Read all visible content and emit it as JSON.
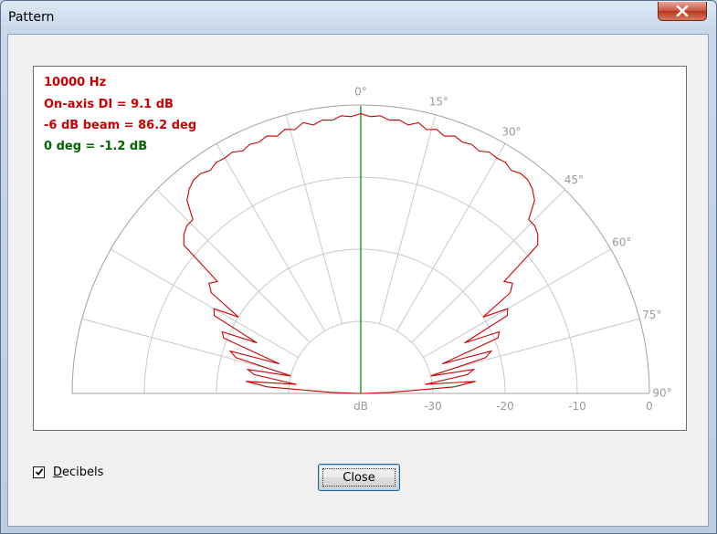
{
  "window": {
    "title": "Pattern"
  },
  "chart_data": {
    "type": "polar",
    "frequency_text": "10000 Hz",
    "di_text": "On-axis DI = 9.1 dB",
    "beam_text": "-6 dB beam = 86.2 deg",
    "zero_deg_text": "0 deg = -1.2 dB",
    "angle_ticks": [
      {
        "deg": 0,
        "label": "0°"
      },
      {
        "deg": 15,
        "label": "15°"
      },
      {
        "deg": 30,
        "label": "30°"
      },
      {
        "deg": 45,
        "label": "45°"
      },
      {
        "deg": 60,
        "label": "60°"
      },
      {
        "deg": 75,
        "label": "75°"
      },
      {
        "deg": 90,
        "label": "90°"
      }
    ],
    "radial_ticks": [
      {
        "db": -40,
        "label": "dB"
      },
      {
        "db": -30,
        "label": "-30"
      },
      {
        "db": -20,
        "label": "-20"
      },
      {
        "db": -10,
        "label": "-10"
      },
      {
        "db": 0,
        "label": "0"
      }
    ],
    "rlim_db": [
      -40,
      0
    ],
    "angle_range_deg": [
      -90,
      90
    ],
    "pattern": [
      [
        -89,
        -39.7
      ],
      [
        -88,
        -36
      ],
      [
        -86,
        -27
      ],
      [
        -84,
        -24
      ],
      [
        -82,
        -31
      ],
      [
        -80,
        -25
      ],
      [
        -78,
        -24
      ],
      [
        -76,
        -30
      ],
      [
        -74,
        -22
      ],
      [
        -72,
        -21
      ],
      [
        -70,
        -28
      ],
      [
        -68,
        -19.5
      ],
      [
        -66,
        -19
      ],
      [
        -64,
        -24
      ],
      [
        -62,
        -17
      ],
      [
        -60,
        -16.5
      ],
      [
        -58,
        -20
      ],
      [
        -56,
        -15
      ],
      [
        -54,
        -14
      ],
      [
        -52,
        -14.8
      ],
      [
        -50,
        -8
      ],
      [
        -48,
        -7
      ],
      [
        -46,
        -6.5
      ],
      [
        -44,
        -6.5
      ],
      [
        -42,
        -4
      ],
      [
        -40,
        -3
      ],
      [
        -38,
        -2.4
      ],
      [
        -36,
        -2.3
      ],
      [
        -34,
        -2.7
      ],
      [
        -32,
        -2.2
      ],
      [
        -30,
        -2.3
      ],
      [
        -28,
        -2.1
      ],
      [
        -26,
        -2.6
      ],
      [
        -24,
        -2.2
      ],
      [
        -22,
        -2.4
      ],
      [
        -20,
        -2
      ],
      [
        -18,
        -2.5
      ],
      [
        -16,
        -1.9
      ],
      [
        -14,
        -2.3
      ],
      [
        -12,
        -1.6
      ],
      [
        -10,
        -2.2
      ],
      [
        -8,
        -1.7
      ],
      [
        -6,
        -1.9
      ],
      [
        -4,
        -1.4
      ],
      [
        -2,
        -1.6
      ],
      [
        0,
        -1.2
      ],
      [
        2,
        -1.6
      ],
      [
        4,
        -1.4
      ],
      [
        6,
        -1.9
      ],
      [
        8,
        -1.7
      ],
      [
        10,
        -2.2
      ],
      [
        12,
        -1.6
      ],
      [
        14,
        -2.3
      ],
      [
        16,
        -1.9
      ],
      [
        18,
        -2.5
      ],
      [
        20,
        -2
      ],
      [
        22,
        -2.4
      ],
      [
        24,
        -2.2
      ],
      [
        26,
        -2.6
      ],
      [
        28,
        -2.1
      ],
      [
        30,
        -2.3
      ],
      [
        32,
        -2.2
      ],
      [
        34,
        -2.7
      ],
      [
        36,
        -2.3
      ],
      [
        38,
        -2.4
      ],
      [
        40,
        -3
      ],
      [
        42,
        -4
      ],
      [
        44,
        -6.5
      ],
      [
        46,
        -6.5
      ],
      [
        48,
        -7
      ],
      [
        50,
        -8
      ],
      [
        52,
        -14.8
      ],
      [
        54,
        -14
      ],
      [
        56,
        -15
      ],
      [
        58,
        -20
      ],
      [
        60,
        -16.5
      ],
      [
        62,
        -17
      ],
      [
        64,
        -24
      ],
      [
        66,
        -19
      ],
      [
        68,
        -19.5
      ],
      [
        70,
        -28
      ],
      [
        72,
        -21
      ],
      [
        74,
        -22
      ],
      [
        76,
        -30
      ],
      [
        78,
        -24
      ],
      [
        80,
        -25
      ],
      [
        82,
        -31
      ],
      [
        84,
        -24
      ],
      [
        86,
        -27
      ],
      [
        88,
        -36
      ],
      [
        89,
        -39.7
      ]
    ],
    "colors": {
      "pattern": "#cc0000",
      "text_red": "#cc0000",
      "text_green": "#006600",
      "axis_line": "#008000",
      "grid": "#c8c8c8",
      "outer": "#a0a0a0",
      "label": "#999999"
    }
  },
  "controls": {
    "decibels_label": "Decibels",
    "decibels_accel": "D",
    "decibels_rest": "ecibels",
    "decibels_checked": true,
    "close_label": "Close"
  }
}
